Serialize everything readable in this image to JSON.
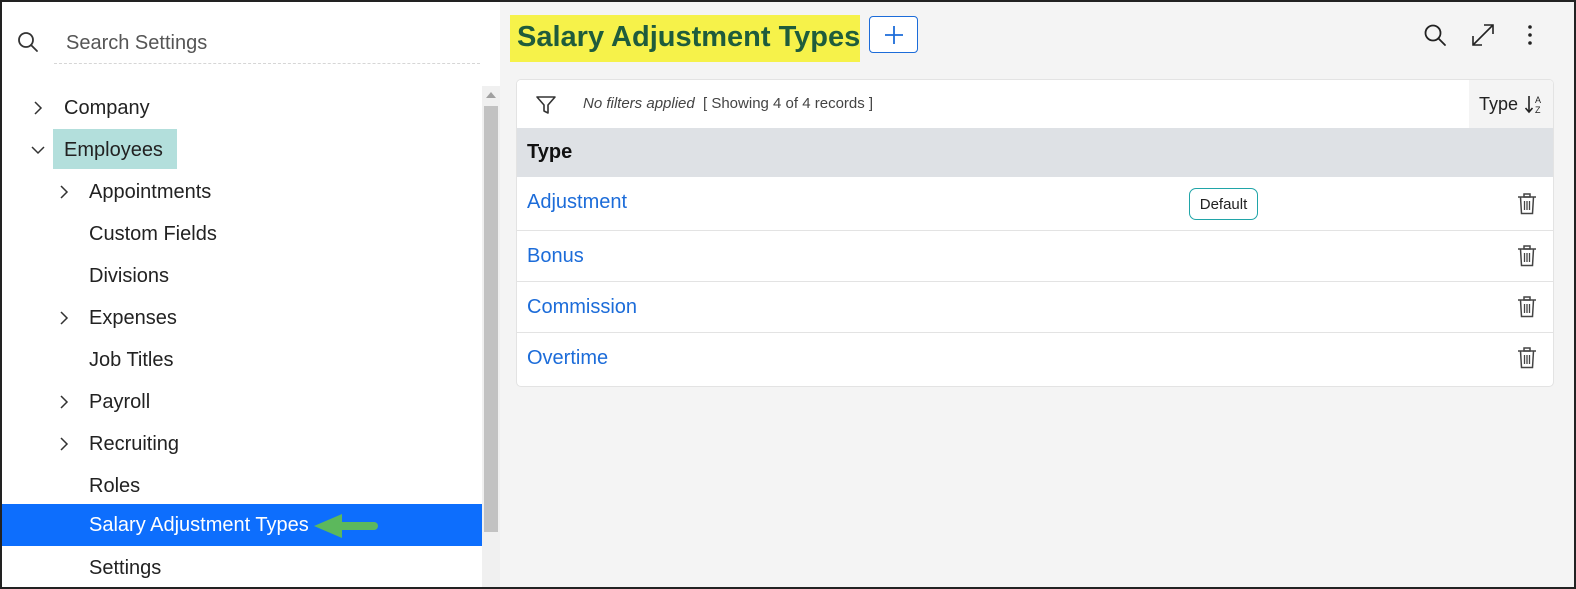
{
  "search": {
    "placeholder": "Search Settings",
    "icon": "search-icon"
  },
  "tree": {
    "items": [
      {
        "label": "Company",
        "level": 0,
        "chevron": "right"
      },
      {
        "label": "Employees",
        "level": 0,
        "chevron": "down",
        "highlighted": true
      },
      {
        "label": "Appointments",
        "level": 1,
        "chevron": "right"
      },
      {
        "label": "Custom Fields",
        "level": 1,
        "chevron": "none"
      },
      {
        "label": "Divisions",
        "level": 1,
        "chevron": "none"
      },
      {
        "label": "Expenses",
        "level": 1,
        "chevron": "right"
      },
      {
        "label": "Job Titles",
        "level": 1,
        "chevron": "none"
      },
      {
        "label": "Payroll",
        "level": 1,
        "chevron": "right"
      },
      {
        "label": "Recruiting",
        "level": 1,
        "chevron": "right"
      },
      {
        "label": "Roles",
        "level": 1,
        "chevron": "none"
      },
      {
        "label": "Salary Adjustment Types",
        "level": 1,
        "chevron": "none",
        "selected": true
      },
      {
        "label": "Settings",
        "level": 1,
        "chevron": "none"
      }
    ]
  },
  "header": {
    "title": "Salary Adjustment Types",
    "add_icon": "plus-icon",
    "icons": [
      "search-icon",
      "expand-icon",
      "more-vertical-icon"
    ]
  },
  "toolbar": {
    "filter_status": "No filters applied",
    "record_count": "[ Showing 4 of 4 records ]",
    "sort_label": "Type",
    "sort_icon": "sort-alpha-down-icon"
  },
  "table": {
    "columns": [
      "Type"
    ],
    "rows": [
      {
        "type": "Adjustment",
        "badge": "Default"
      },
      {
        "type": "Bonus",
        "badge": ""
      },
      {
        "type": "Commission",
        "badge": ""
      },
      {
        "type": "Overtime",
        "badge": ""
      }
    ]
  },
  "colors": {
    "accent": "#0d6efd",
    "link": "#1c6cd9",
    "title": "#1f5c3c",
    "title_highlight": "#f6f24a",
    "employees_highlight": "#b3dfdc",
    "arrow": "#5cb85c"
  }
}
